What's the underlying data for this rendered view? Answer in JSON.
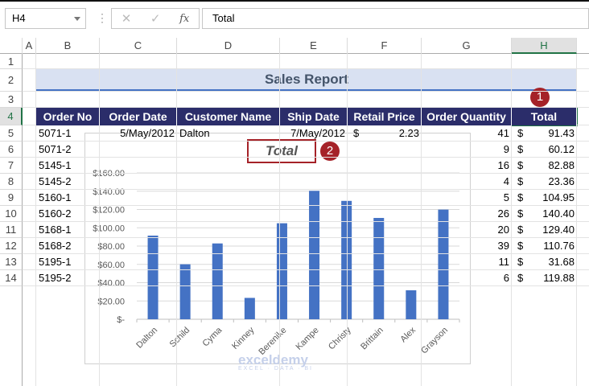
{
  "formula_bar": {
    "name_box": "H4",
    "formula": "Total",
    "cancel_icon": "✕",
    "enter_icon": "✓",
    "fx_label": "fx"
  },
  "columns": [
    "A",
    "B",
    "C",
    "D",
    "E",
    "F",
    "G",
    "H"
  ],
  "rows": [
    "1",
    "2",
    "3",
    "4",
    "5",
    "6",
    "7",
    "8",
    "9",
    "10",
    "11",
    "12",
    "13",
    "14"
  ],
  "selected_cell": "H4",
  "sheet": {
    "title": "Sales Report",
    "headers": [
      "Order No",
      "Order Date",
      "Customer Name",
      "Ship Date",
      "Retail Price",
      "Order Quantity",
      "Total"
    ],
    "row5_partial": {
      "order_date": "5/May/2012",
      "customer": "Dalton",
      "ship_date": "7/May/2012",
      "price_symbol": "$",
      "price": "2.23"
    },
    "data": [
      {
        "order_no": "5071-1",
        "qty": "41",
        "total": "91.43"
      },
      {
        "order_no": "5071-2",
        "qty": "9",
        "total": "60.12"
      },
      {
        "order_no": "5145-1",
        "qty": "16",
        "total": "82.88"
      },
      {
        "order_no": "5145-2",
        "qty": "4",
        "total": "23.36"
      },
      {
        "order_no": "5160-1",
        "qty": "5",
        "total": "104.95"
      },
      {
        "order_no": "5160-2",
        "qty": "26",
        "total": "140.40"
      },
      {
        "order_no": "5168-1",
        "qty": "20",
        "total": "129.40"
      },
      {
        "order_no": "5168-2",
        "qty": "39",
        "total": "110.76"
      },
      {
        "order_no": "5195-1",
        "qty": "11",
        "total": "31.68"
      },
      {
        "order_no": "5195-2",
        "qty": "6",
        "total": "119.88"
      }
    ],
    "currency": "$"
  },
  "badges": [
    "1",
    "2"
  ],
  "chart_data": {
    "type": "bar",
    "title": "Total",
    "categories": [
      "Dalton",
      "Schild",
      "Cyma",
      "Kinney",
      "Berenike",
      "Kampe",
      "Christy",
      "Brittain",
      "Alex",
      "Grayson"
    ],
    "values": [
      91.43,
      60.12,
      82.88,
      23.36,
      104.95,
      140.4,
      129.4,
      110.76,
      31.68,
      119.88
    ],
    "ylim": [
      0,
      160
    ],
    "yticks": [
      "$-",
      "$20.00",
      "$40.00",
      "$60.00",
      "$80.00",
      "$100.00",
      "$120.00",
      "$140.00",
      "$160.00"
    ],
    "grid": true,
    "bar_color": "#4472c4"
  },
  "watermark": {
    "name": "exceldemy",
    "tagline": "EXCEL · DATA · BI"
  }
}
